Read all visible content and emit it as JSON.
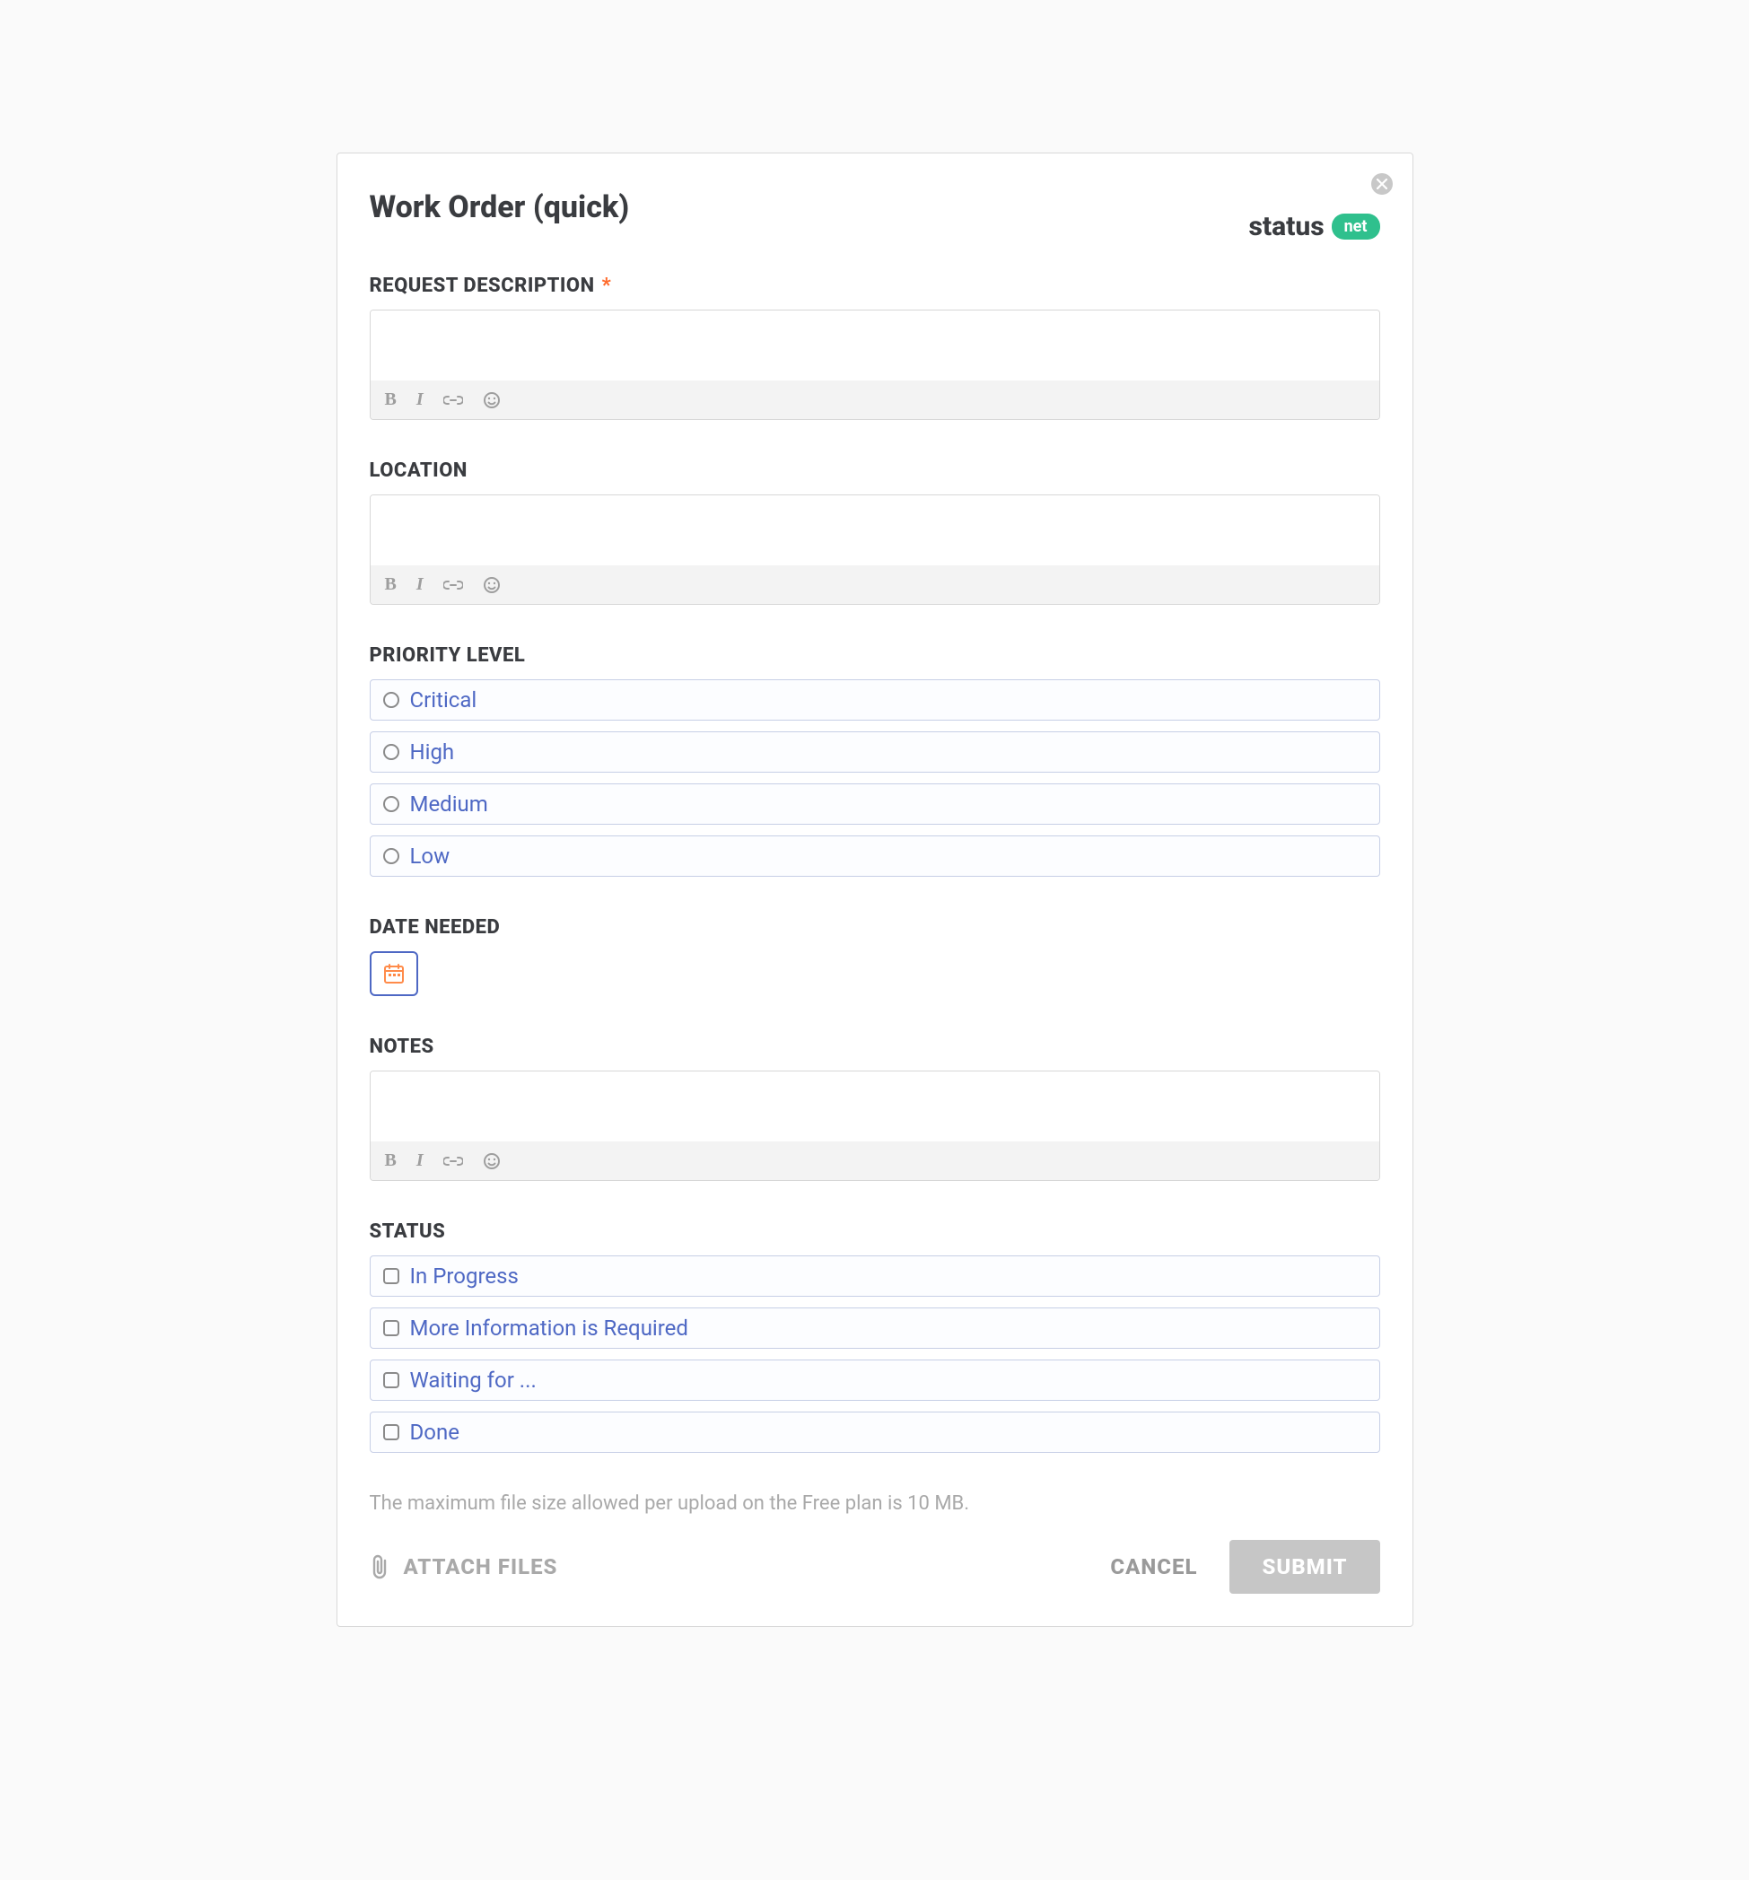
{
  "header": {
    "title": "Work Order (quick)",
    "brand_text": "status",
    "brand_badge": "net"
  },
  "fields": {
    "request_description": {
      "label": "REQUEST DESCRIPTION",
      "required": true
    },
    "location": {
      "label": "LOCATION"
    },
    "priority": {
      "label": "PRIORITY LEVEL",
      "options": [
        "Critical",
        "High",
        "Medium",
        "Low"
      ]
    },
    "date_needed": {
      "label": "DATE NEEDED"
    },
    "notes": {
      "label": "NOTES"
    },
    "status": {
      "label": "STATUS",
      "options": [
        "In Progress",
        "More Information is Required",
        "Waiting for ...",
        "Done"
      ]
    }
  },
  "footer": {
    "file_hint": "The maximum file size allowed per upload on the Free plan is 10 MB.",
    "attach_label": "ATTACH FILES",
    "cancel_label": "CANCEL",
    "submit_label": "SUBMIT"
  },
  "required_marker": "*"
}
